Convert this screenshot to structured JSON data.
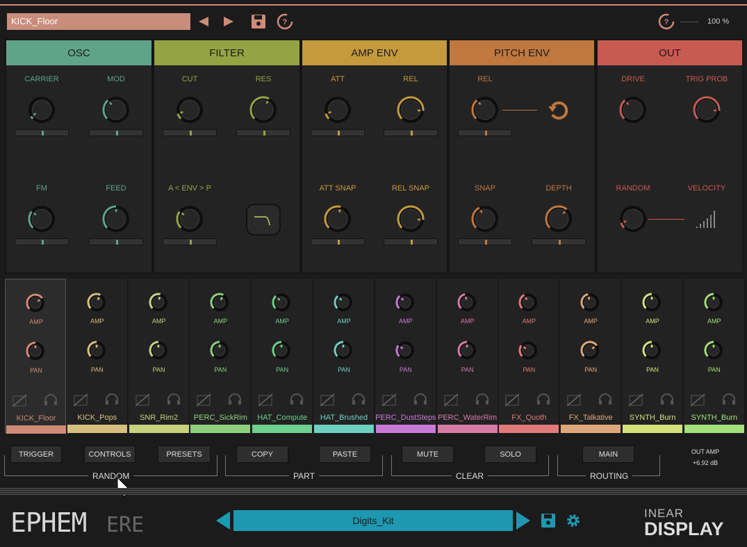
{
  "header": {
    "preset_name": "KICK_Floor",
    "zoom": "100 %"
  },
  "sections": [
    {
      "title": "OSC",
      "color": "#5fa48a"
    },
    {
      "title": "FILTER",
      "color": "#94a442"
    },
    {
      "title": "AMP ENV",
      "color": "#c59a3c"
    },
    {
      "title": "PITCH ENV",
      "color": "#c0783e"
    },
    {
      "title": "OUT",
      "color": "#c85a52"
    }
  ],
  "osc": {
    "carrier": "CARRIER",
    "mod": "MOD",
    "fm": "FM",
    "feed": "FEED"
  },
  "filter": {
    "cut": "CUT",
    "res": "RES",
    "aenvp": "A < ENV > P"
  },
  "ampenv": {
    "att": "ATT",
    "rel": "REL",
    "attsnap": "ATT SNAP",
    "relsnap": "REL SNAP"
  },
  "pitchenv": {
    "rel": "REL",
    "snap": "SNAP",
    "depth": "DEPTH"
  },
  "out": {
    "drive": "DRIVE",
    "trigprob": "TRIG PROB",
    "random": "RANDOM",
    "velocity": "VELOCITY"
  },
  "knob_values": {
    "carrier": 0.05,
    "mod": 0.35,
    "fm": 0.3,
    "feed": 0.5,
    "cut": 0.1,
    "res": 0.6,
    "aenvp": 0.3,
    "att": 0.1,
    "rel": 0.85,
    "attsnap": 0.55,
    "relsnap": 0.85,
    "p_rel": 0.35,
    "snap": 0.4,
    "depth": 0.65,
    "drive": 0.35,
    "trigprob": 0.85,
    "random": 0.1
  },
  "strips": [
    {
      "name": "KICK_Floor",
      "color": "#d08a78",
      "amp": 0.7,
      "pan": 0.5
    },
    {
      "name": "KICK_Pops",
      "color": "#d6bf7e",
      "amp": 0.6,
      "pan": 0.5
    },
    {
      "name": "SNR_Rim2",
      "color": "#c6d27e",
      "amp": 0.55,
      "pan": 0.5
    },
    {
      "name": "PERC_SickRim",
      "color": "#8fd07e",
      "amp": 0.6,
      "pan": 0.5
    },
    {
      "name": "HAT_Compute",
      "color": "#6ed08e",
      "amp": 0.35,
      "pan": 0.5
    },
    {
      "name": "HAT_Brushed",
      "color": "#6ed0c0",
      "amp": 0.35,
      "pan": 0.5
    },
    {
      "name": "PERC_DustSteps",
      "color": "#c97ad6",
      "amp": 0.35,
      "pan": 0.3
    },
    {
      "name": "PERC_WaterRim",
      "color": "#d67aa6",
      "amp": 0.45,
      "pan": 0.5
    },
    {
      "name": "FX_Quoth",
      "color": "#e07a7a",
      "amp": 0.4,
      "pan": 0.3
    },
    {
      "name": "FX_Talkative",
      "color": "#e0a87a",
      "amp": 0.45,
      "pan": 0.7
    },
    {
      "name": "SYNTH_Burn",
      "color": "#d4e07a",
      "amp": 0.5,
      "pan": 0.5
    },
    {
      "name": "SYNTH_Burn",
      "color": "#a2e07a",
      "amp": 0.5,
      "pan": 0.5
    }
  ],
  "strip_labels": {
    "amp": "AMP",
    "pan": "PAN"
  },
  "bottom": {
    "trigger": "TRIGGER",
    "controls": "CONTROLS",
    "presets": "PRESETS",
    "copy": "COPY",
    "paste": "PASTE",
    "mute": "MUTE",
    "solo": "SOLO",
    "main": "MAIN",
    "random": "RANDOM",
    "part": "PART",
    "clear": "CLEAR",
    "routing": "ROUTING",
    "out_amp_label": "OUT AMP",
    "out_amp_value": "+6.92 dB"
  },
  "footer": {
    "kit_name": "Digits_Kit",
    "brand_left": "ephem",
    "brand_right": "INEAR DISPLAY"
  }
}
